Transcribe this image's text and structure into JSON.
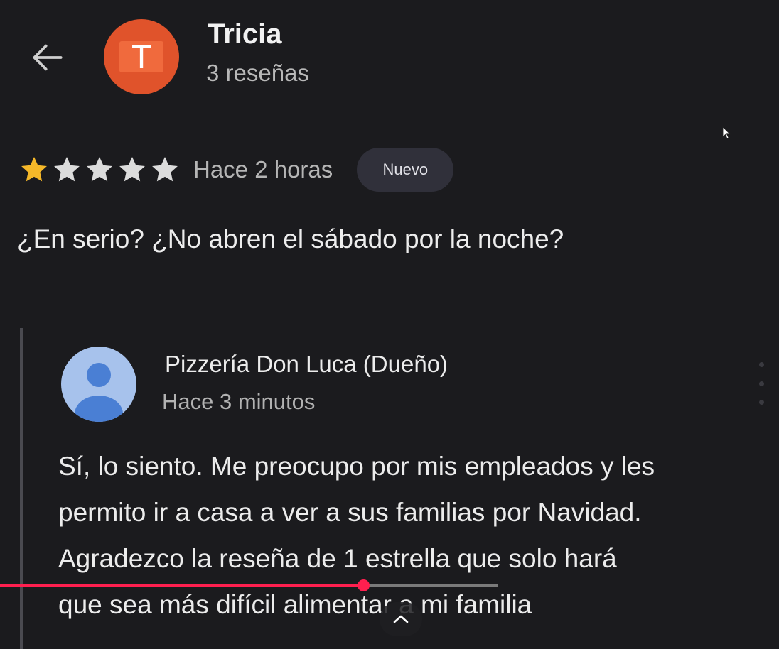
{
  "reviewer": {
    "initial": "T",
    "name": "Tricia",
    "review_count": "3 reseñas"
  },
  "rating": {
    "stars_filled": 1,
    "stars_total": 5,
    "time_ago": "Hace 2 horas",
    "badge": "Nuevo"
  },
  "review": {
    "text": "¿En serio? ¿No abren el sábado por la noche?"
  },
  "owner_reply": {
    "name": "Pizzería Don Luca (Dueño)",
    "time_ago": "Hace 3 minutos",
    "lines": [
      "Sí, lo siento. Me preocupo por mis empleados y les",
      "permito ir a casa a ver a sus familias por Navidad.",
      "Agradezco la reseña de 1 estrella que solo hará",
      "que sea más difícil alimentar a mi familia"
    ]
  },
  "video": {
    "progress": 0.73
  },
  "colors": {
    "background": "#1b1b1e",
    "reviewer_avatar": "#e0532b",
    "star_filled": "#f5b829",
    "star_empty": "#dcdcdc",
    "owner_avatar": "#a7c2ec",
    "progress": "#ff1f4f"
  },
  "icons": {
    "back": "arrow-left-icon",
    "star": "star-icon",
    "owner_avatar": "person-icon",
    "expand": "chevron-up-icon",
    "cursor": "mouse-pointer-icon"
  }
}
